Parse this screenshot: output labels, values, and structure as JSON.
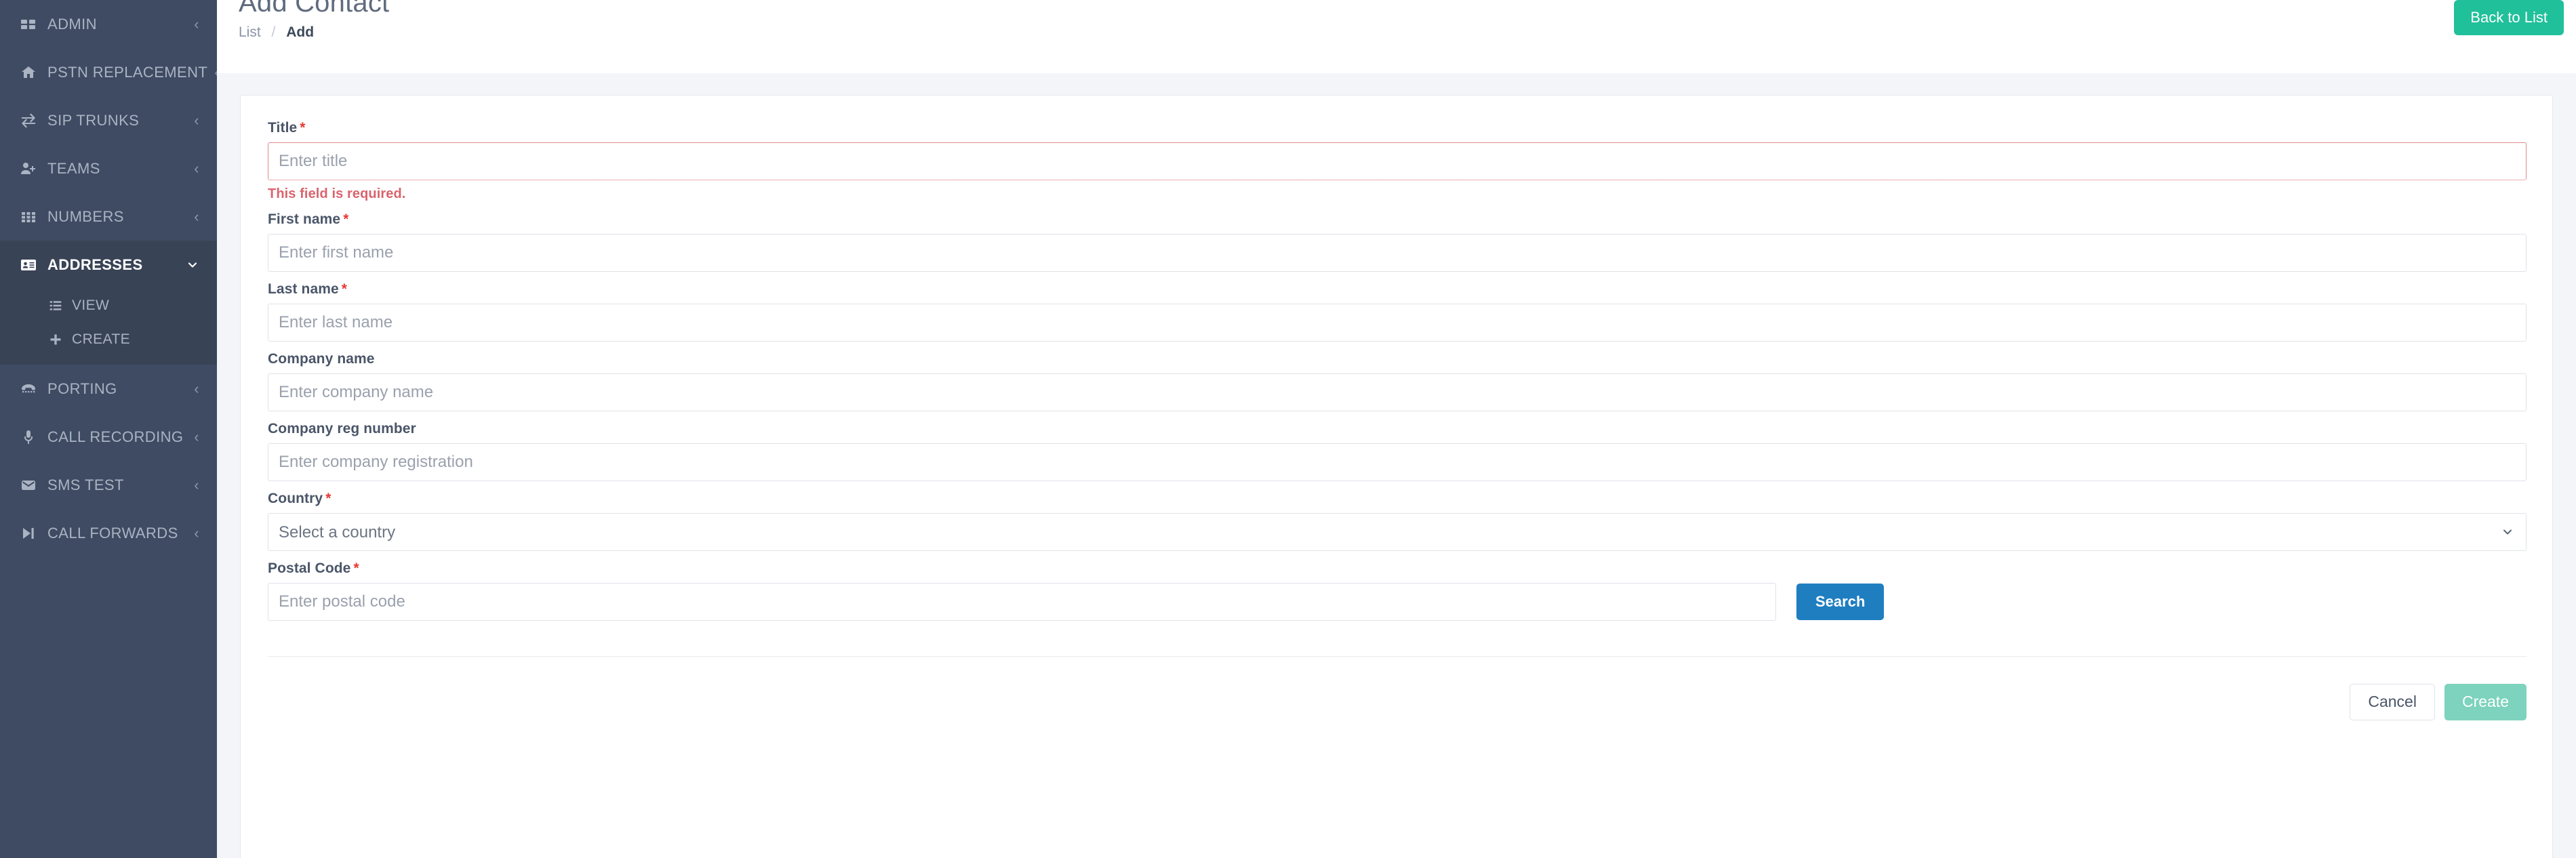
{
  "sidebar": {
    "items": [
      {
        "label": "ADMIN",
        "icon": "grid-icon",
        "chevron": "chevron-left-icon",
        "active": false
      },
      {
        "label": "PSTN REPLACEMENT",
        "icon": "home-icon",
        "chevron": "chevron-left-icon",
        "active": false
      },
      {
        "label": "SIP TRUNKS",
        "icon": "exchange-arrows-icon",
        "chevron": "chevron-left-icon",
        "active": false
      },
      {
        "label": "TEAMS",
        "icon": "user-plus-icon",
        "chevron": "chevron-left-icon",
        "active": false
      },
      {
        "label": "NUMBERS",
        "icon": "grid-nine-icon",
        "chevron": "chevron-left-icon",
        "active": false
      },
      {
        "label": "ADDRESSES",
        "icon": "id-card-icon",
        "chevron": "chevron-down-icon",
        "active": true
      },
      {
        "label": "PORTING",
        "icon": "phone-keypad-icon",
        "chevron": "chevron-left-icon",
        "active": false
      },
      {
        "label": "CALL RECORDING",
        "icon": "microphone-icon",
        "chevron": "chevron-left-icon",
        "active": false
      },
      {
        "label": "SMS TEST",
        "icon": "envelope-icon",
        "chevron": "chevron-left-icon",
        "active": false
      },
      {
        "label": "CALL FORWARDS",
        "icon": "forward-step-icon",
        "chevron": "chevron-left-icon",
        "active": false
      }
    ],
    "subitems": [
      {
        "label": "VIEW",
        "icon": "list-icon"
      },
      {
        "label": "CREATE",
        "icon": "plus-icon"
      }
    ]
  },
  "header": {
    "title": "Add Contact",
    "breadcrumb": {
      "root": "List",
      "separator": "/",
      "current": "Add"
    },
    "back_button": "Back to List"
  },
  "form": {
    "title": {
      "label": "Title",
      "required": "*",
      "placeholder": "Enter title",
      "value": "",
      "error": "This field is required."
    },
    "first_name": {
      "label": "First name",
      "required": "*",
      "placeholder": "Enter first name",
      "value": ""
    },
    "last_name": {
      "label": "Last name",
      "required": "*",
      "placeholder": "Enter last name",
      "value": ""
    },
    "company_name": {
      "label": "Company name",
      "placeholder": "Enter company name",
      "value": ""
    },
    "company_reg_number": {
      "label": "Company reg number",
      "placeholder": "Enter company registration",
      "value": ""
    },
    "country": {
      "label": "Country",
      "required": "*",
      "placeholder": "Select a country",
      "selected": "Select a country",
      "options": [
        "Select a country"
      ]
    },
    "postal_code": {
      "label": "Postal Code",
      "required": "*",
      "placeholder": "Enter postal code",
      "value": "",
      "search_button": "Search"
    },
    "actions": {
      "cancel": "Cancel",
      "create": "Create"
    }
  },
  "colors": {
    "sidebar_bg": "#3e4b63",
    "sidebar_active_bg": "#394356",
    "page_bg": "#f4f5f9",
    "back_button": "#20c09a",
    "search_button": "#1f7ec0",
    "create_button": "#7dd3bd",
    "error": "#d9646d",
    "required_asterisk": "#e53935"
  }
}
